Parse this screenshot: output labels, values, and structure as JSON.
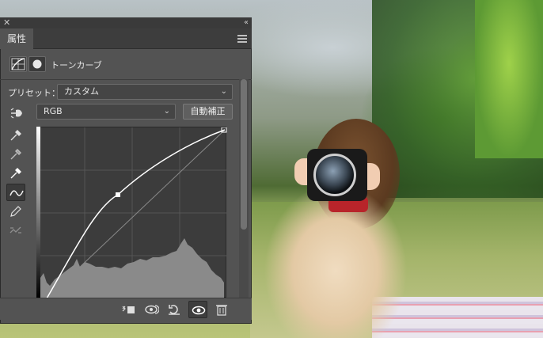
{
  "window": {
    "close_glyph": "✕",
    "collapse_glyph": "‹‹"
  },
  "panel": {
    "tab_label": "属性",
    "menu_icon": "panel-menu-icon",
    "header": {
      "title": "トーンカーブ",
      "icons": [
        "curves-adjustment-icon",
        "mask-icon"
      ]
    },
    "preset": {
      "label": "プリセット：",
      "value": "カスタム"
    },
    "channel": {
      "value": "RGB"
    },
    "auto_button": "自動補正",
    "tools": [
      "on-image-adjust-icon",
      "black-point-eyedropper-icon",
      "gray-point-eyedropper-icon",
      "white-point-eyedropper-icon",
      "curve-point-icon",
      "pencil-icon",
      "smooth-icon"
    ],
    "footer_icons": [
      "clip-to-layer-icon",
      "view-previous-state-icon",
      "reset-icon",
      "visibility-icon",
      "trash-icon"
    ]
  },
  "colors": {
    "panel_bg": "#535353",
    "graph_bg": "#3c3c3c",
    "histogram": "#8a8a8a",
    "curve": "#ffffff"
  }
}
